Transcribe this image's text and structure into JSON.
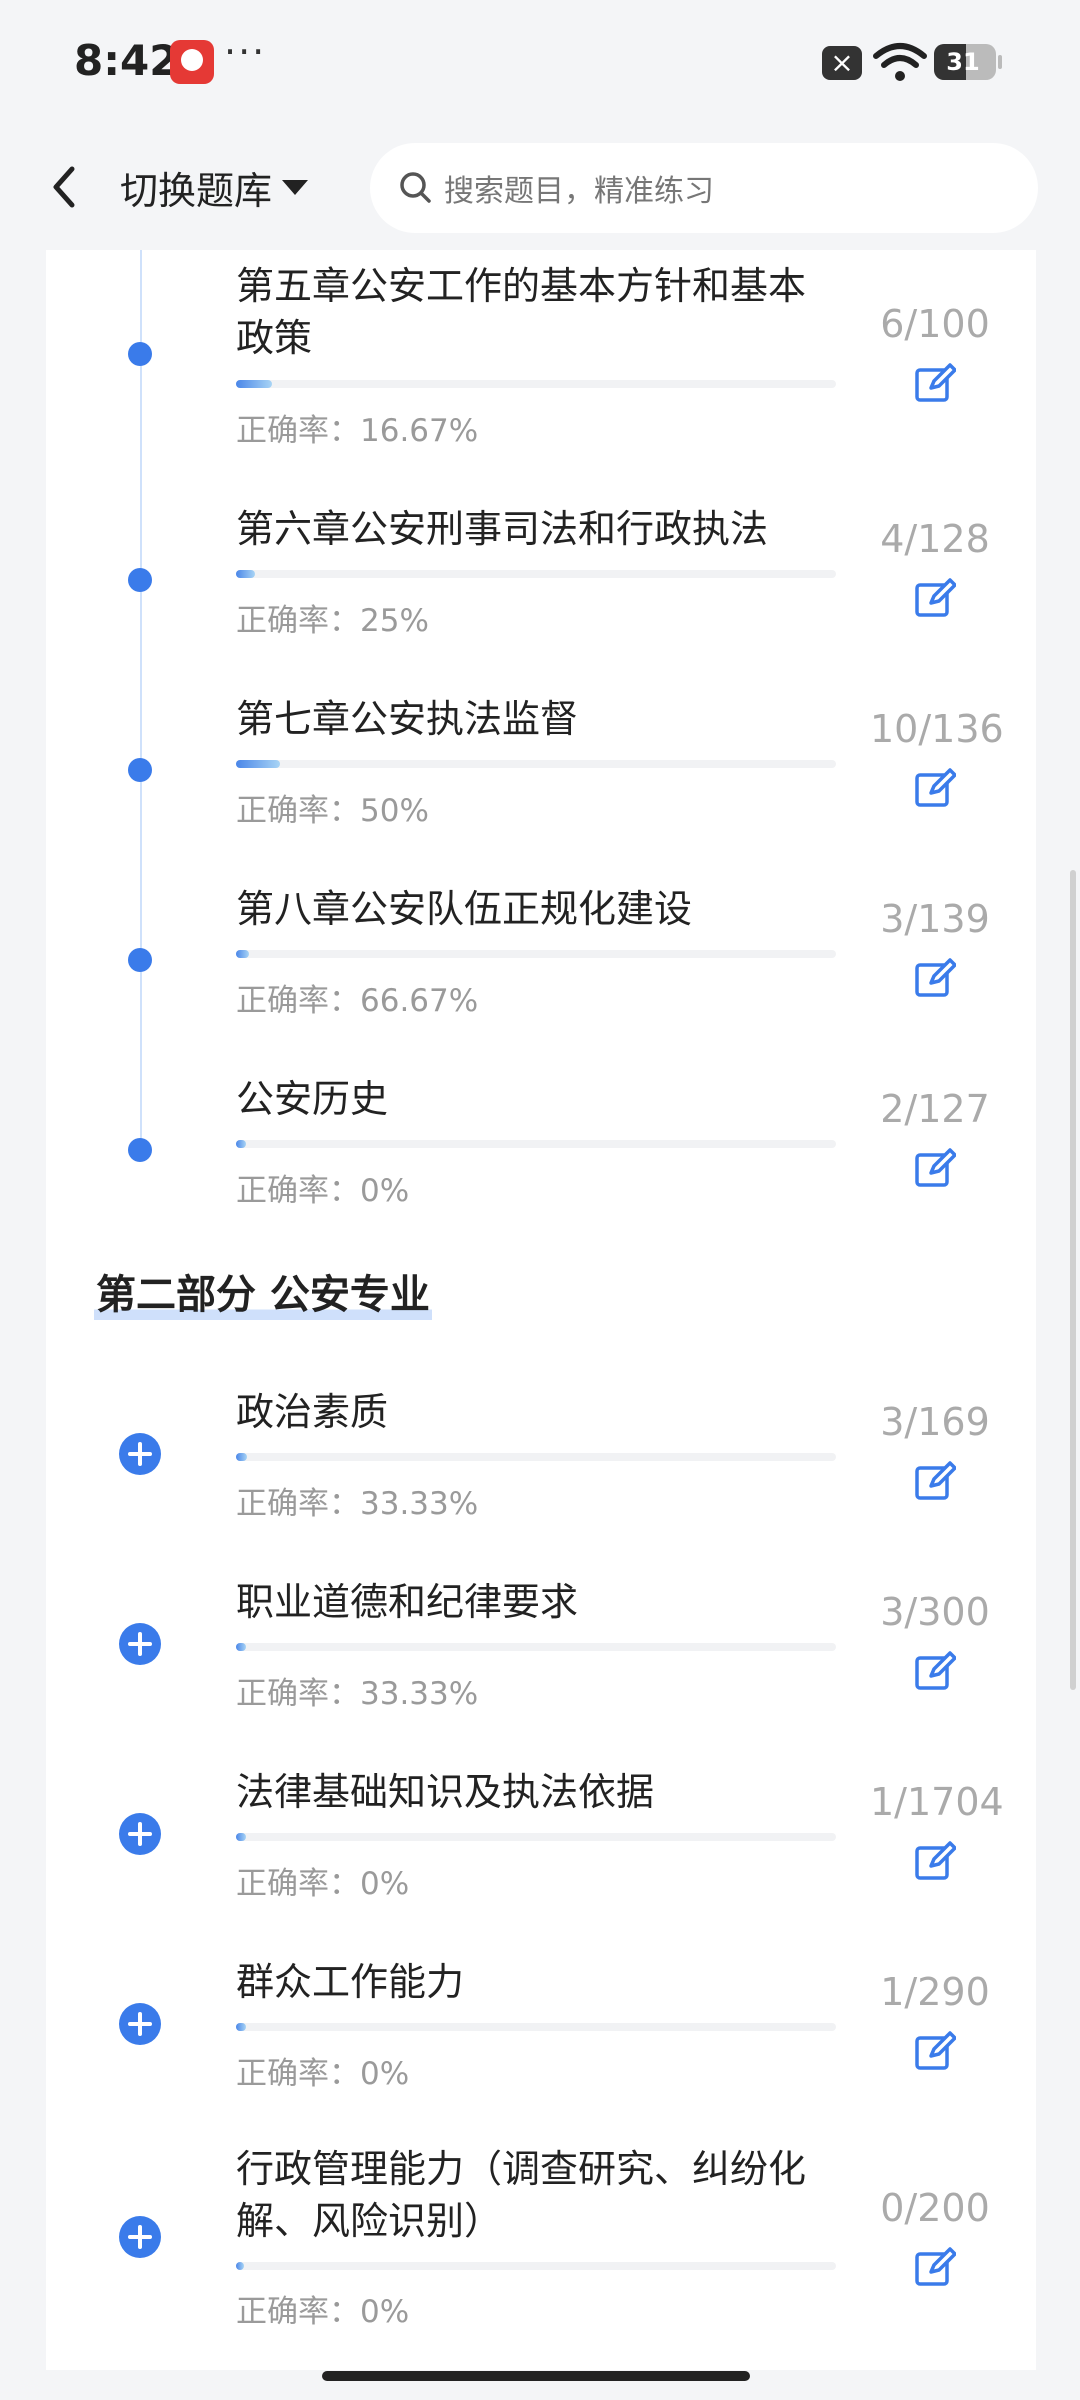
{
  "status": {
    "time": "8:42",
    "more": "···",
    "battery": "31"
  },
  "header": {
    "bank_label": "切换题库",
    "search_placeholder": "搜索题目，精准练习"
  },
  "part1": {
    "chapters": [
      {
        "title": "第五章公安工作的基本方针和基本政策",
        "accuracy": "正确率：16.67%",
        "count": "6/100",
        "progress": 0.06
      },
      {
        "title": "第六章公安刑事司法和行政执法",
        "accuracy": "正确率：25%",
        "count": "4/128",
        "progress": 0.031
      },
      {
        "title": "第七章公安执法监督",
        "accuracy": "正确率：50%",
        "count": "10/136",
        "progress": 0.074
      },
      {
        "title": "第八章公安队伍正规化建设",
        "accuracy": "正确率：66.67%",
        "count": "3/139",
        "progress": 0.022
      },
      {
        "title": "公安历史",
        "accuracy": "正确率：0%",
        "count": "2/127",
        "progress": 0.016
      }
    ]
  },
  "part2": {
    "title": "第二部分 公安专业",
    "chapters": [
      {
        "title": "政治素质",
        "accuracy": "正确率：33.33%",
        "count": "3/169",
        "progress": 0.018
      },
      {
        "title": "职业道德和纪律要求",
        "accuracy": "正确率：33.33%",
        "count": "3/300",
        "progress": 0.01
      },
      {
        "title": "法律基础知识及执法依据",
        "accuracy": "正确率：0%",
        "count": "1/1704",
        "progress": 0.001
      },
      {
        "title": "群众工作能力",
        "accuracy": "正确率：0%",
        "count": "1/290",
        "progress": 0.003
      },
      {
        "title": "行政管理能力（调查研究、纠纷化解、风险识别）",
        "accuracy": "正确率：0%",
        "count": "0/200",
        "progress": 0
      }
    ]
  },
  "colors": {
    "accent": "#3a7bea",
    "progress_start": "#4a86e8",
    "progress_end": "#a8d4f5"
  }
}
